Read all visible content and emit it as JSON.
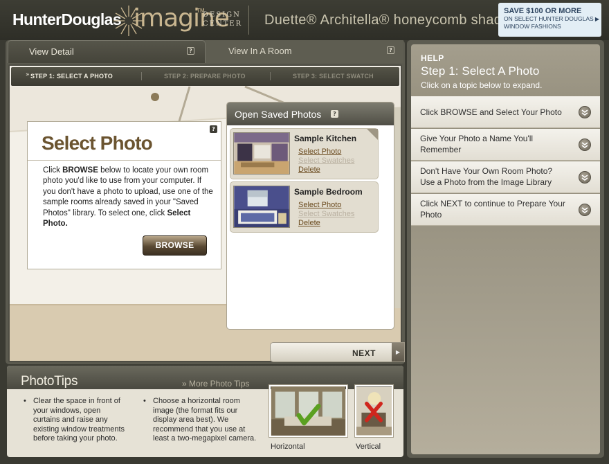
{
  "header": {
    "brand": "HunterDouglas",
    "imagine": "imagine",
    "imagine_tm": "TM",
    "design_center": "DESIGN CENTER",
    "product_title": "Duette® Architella® honeycomb shades",
    "promo_headline": "SAVE $100 OR MORE",
    "promo_sub1": "ON SELECT HUNTER DOUGLAS",
    "promo_sub2": "WINDOW FASHIONS"
  },
  "tabs": [
    {
      "label": "View Detail",
      "active": true
    },
    {
      "label": "View In A Room",
      "active": false
    }
  ],
  "help_glyph": "?",
  "steps": [
    {
      "label": "STEP 1: SELECT A PHOTO",
      "active": true
    },
    {
      "label": "STEP 2: PREPARE PHOTO",
      "active": false
    },
    {
      "label": "STEP 3: SELECT SWATCH",
      "active": false
    }
  ],
  "select_photo": {
    "title": "Select Photo",
    "body_1": "Click ",
    "body_browse": "BROWSE",
    "body_2": " below to locate your own room photo you'd like to use from your computer. If you don't have a photo to upload, use one of the sample rooms already saved in your \"Saved Photos\" library. To select one, click ",
    "body_select": "Select Photo.",
    "browse_label": "BROWSE"
  },
  "saved_photos": {
    "title": "Open Saved Photos",
    "items": [
      {
        "name": "Sample Kitchen",
        "select": "Select Photo",
        "swatches": "Select Swatches",
        "delete": "Delete"
      },
      {
        "name": "Sample Bedroom",
        "select": "Select Photo",
        "swatches": "Select Swatches",
        "delete": "Delete"
      }
    ]
  },
  "next_label": "NEXT",
  "photo_tips": {
    "title": "PhotoTips",
    "more": "» More Photo Tips",
    "tip1": "Clear the space in front of your windows, open curtains and raise any existing window treatments before taking your photo.",
    "tip2": "Choose a horizontal room image (the format fits our display area best). We recommend that you use at least a two-megapixel camera.",
    "horizontal_caption": "Horizontal",
    "vertical_caption": "Vertical"
  },
  "help": {
    "label": "HELP",
    "title": "Step 1: Select A Photo",
    "subtitle": "Click on a topic below to expand.",
    "items": [
      "Click BROWSE and Select Your Photo",
      "Give Your Photo a Name You'll Remember",
      "Don't Have Your Own Room Photo? Use a Photo from the Image Library",
      "Click NEXT to continue to Prepare Your Photo"
    ]
  },
  "colors": {
    "accent_brown": "#6b5430",
    "link": "#6a4a1e",
    "frame": "#5b5a4f",
    "promo_bg": "#e3eef5"
  }
}
